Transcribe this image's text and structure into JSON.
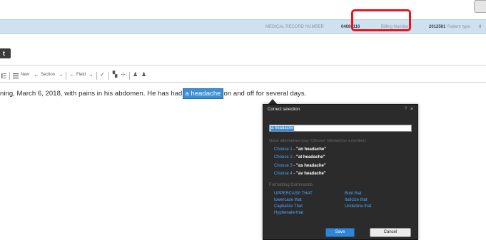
{
  "patient_bar": {
    "mrn_label": "MEDICAL RECORD NUMBER",
    "mrn_value": "04080116",
    "billing_label": "Billing Number",
    "billing_value": "2012561",
    "patient_type_label": "Patient type",
    "patient_type_value": "I"
  },
  "doc_title_chip": "t",
  "toolbar": {
    "new_label": "New",
    "section_label": "Section",
    "field_label": "Field"
  },
  "document": {
    "before": "ning, March 6, 2018, with pains in his abdomen.  He has had",
    "selected": "a headache",
    "after": "on and off for several days."
  },
  "dialog": {
    "title": "Correct selection",
    "help": "?",
    "close": "×",
    "input_value": "a headache",
    "hint": "Quick alternatives (say \"Choose\" followed by a number)",
    "alternatives": [
      {
        "choose": "Choose 1",
        "value": "\"an headache\""
      },
      {
        "choose": "Choose 2",
        "value": "\"at headache\""
      },
      {
        "choose": "Choose 3",
        "value": "\"as headache\""
      },
      {
        "choose": "Choose 4",
        "value": "\"av headache\""
      }
    ],
    "formatting_header": "Formatting Commands",
    "commands": {
      "uppercase": "UPPERCASE THAT",
      "lowercase": "lowercase that",
      "capitalize": "Capitalize That",
      "hyphenate": "Hyphenate-that",
      "bold": "Bold that",
      "italicize": "Italicize that",
      "underline": "Underline that"
    },
    "save_label": "Save",
    "cancel_label": "Cancel"
  }
}
